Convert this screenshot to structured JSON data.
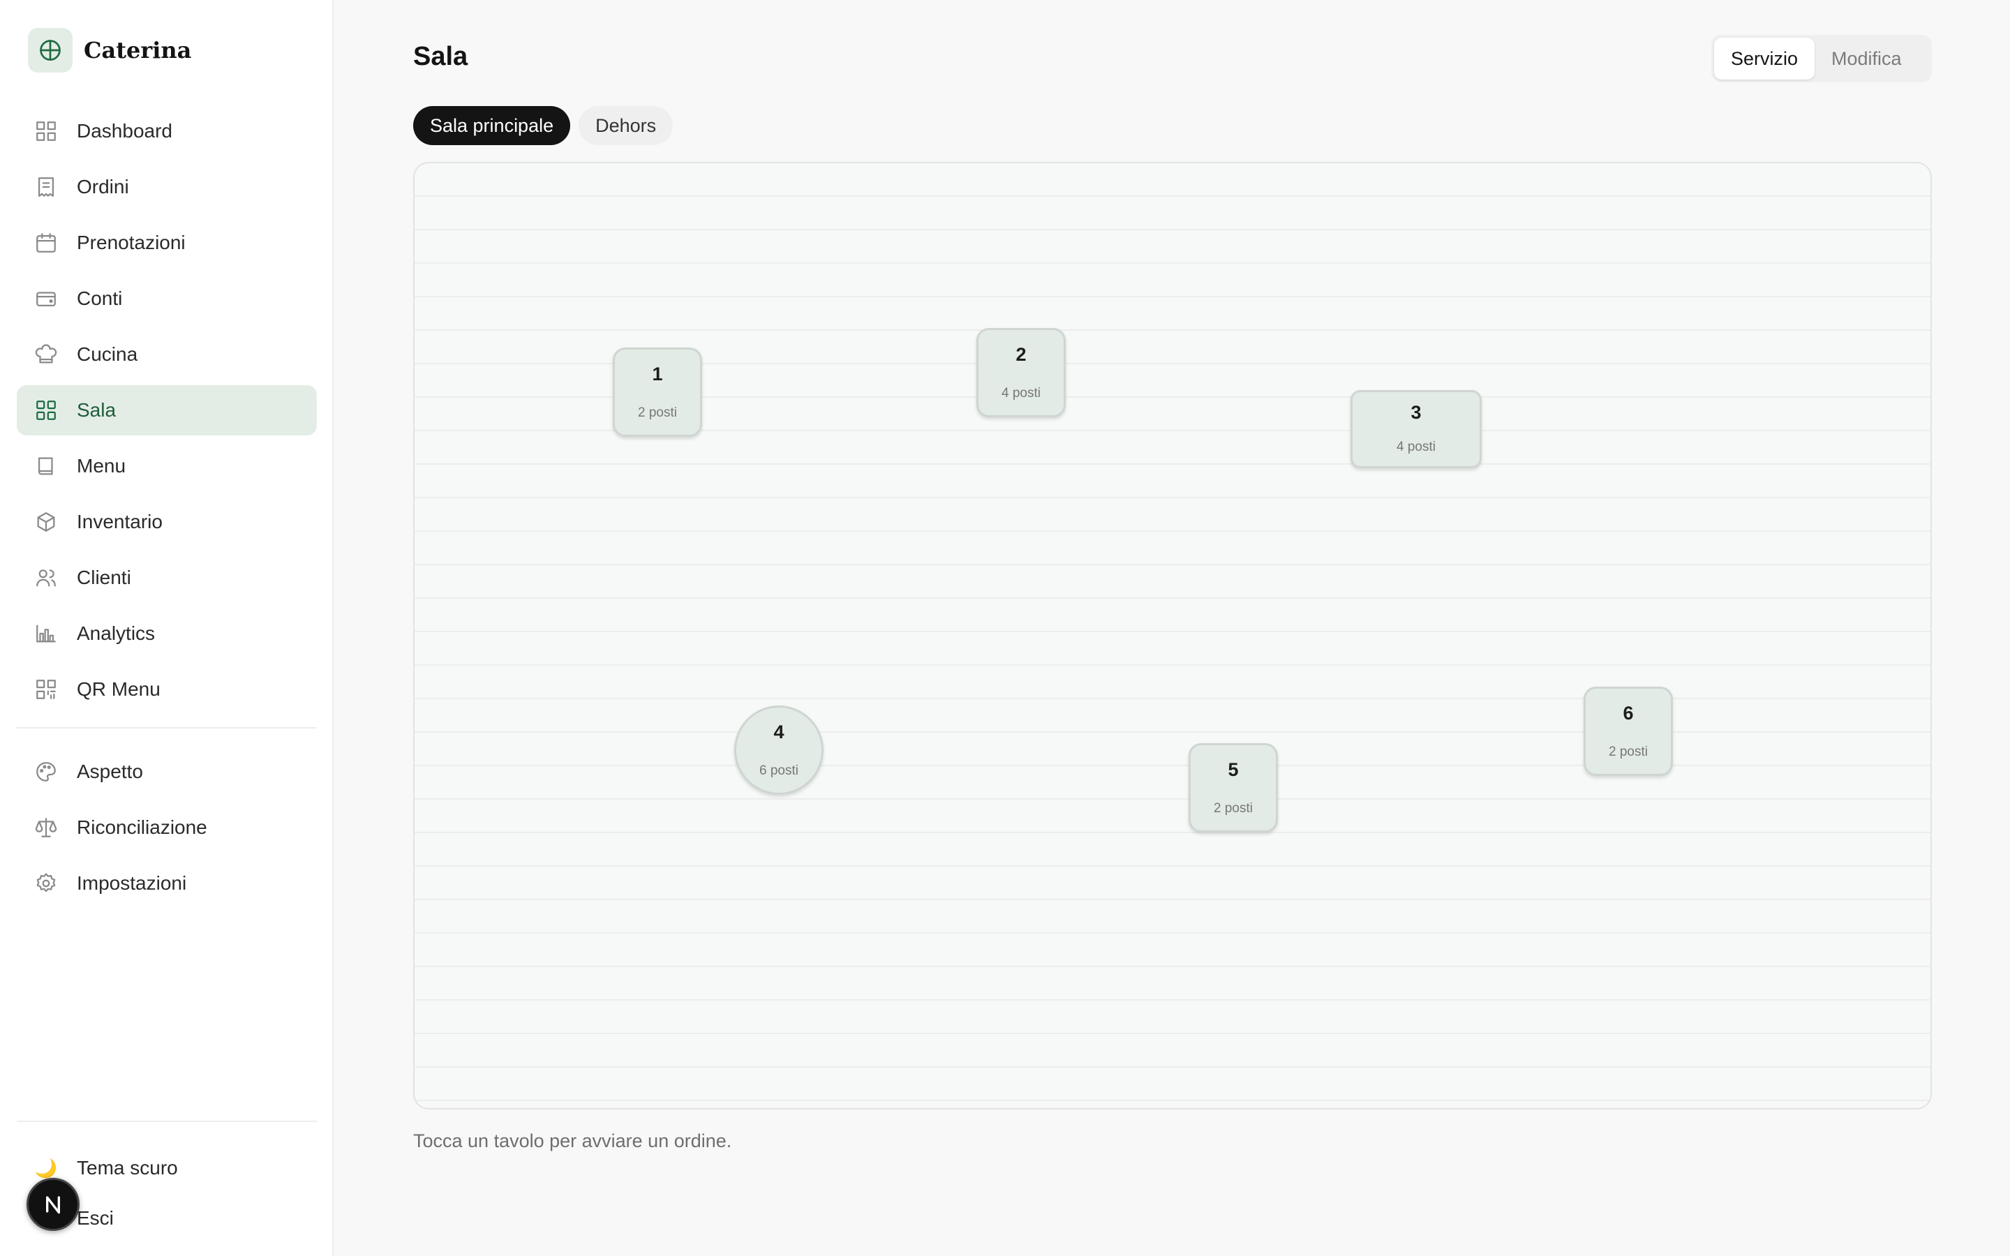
{
  "brand": {
    "name": "Caterina",
    "logo_icon": "globe-icon"
  },
  "sidebar": {
    "items": [
      {
        "label": "Dashboard",
        "icon": "dashboard-icon",
        "active": false
      },
      {
        "label": "Ordini",
        "icon": "receipt-icon",
        "active": false
      },
      {
        "label": "Prenotazioni",
        "icon": "calendar-icon",
        "active": false
      },
      {
        "label": "Conti",
        "icon": "wallet-icon",
        "active": false
      },
      {
        "label": "Cucina",
        "icon": "chef-hat-icon",
        "active": false
      },
      {
        "label": "Sala",
        "icon": "grid-icon",
        "active": true
      },
      {
        "label": "Menu",
        "icon": "book-icon",
        "active": false
      },
      {
        "label": "Inventario",
        "icon": "box-icon",
        "active": false
      },
      {
        "label": "Clienti",
        "icon": "users-icon",
        "active": false
      },
      {
        "label": "Analytics",
        "icon": "bar-chart-icon",
        "active": false
      },
      {
        "label": "QR Menu",
        "icon": "qr-code-icon",
        "active": false
      }
    ],
    "secondary_items": [
      {
        "label": "Aspetto",
        "icon": "palette-icon"
      },
      {
        "label": "Riconciliazione",
        "icon": "scale-icon"
      },
      {
        "label": "Impostazioni",
        "icon": "gear-icon"
      }
    ],
    "bottom": {
      "theme_label": "Tema scuro",
      "theme_icon": "🌙",
      "logout_label": "Esci"
    }
  },
  "header": {
    "title": "Sala",
    "modes": [
      {
        "label": "Servizio",
        "active": true
      },
      {
        "label": "Modifica",
        "active": false
      }
    ]
  },
  "rooms": [
    {
      "label": "Sala principale",
      "active": true
    },
    {
      "label": "Dehors",
      "active": false
    }
  ],
  "tables": [
    {
      "number": "1",
      "seats": "2 posti",
      "shape": "square"
    },
    {
      "number": "2",
      "seats": "4 posti",
      "shape": "square"
    },
    {
      "number": "3",
      "seats": "4 posti",
      "shape": "rect"
    },
    {
      "number": "4",
      "seats": "6 posti",
      "shape": "round"
    },
    {
      "number": "5",
      "seats": "2 posti",
      "shape": "square"
    },
    {
      "number": "6",
      "seats": "2 posti",
      "shape": "square"
    }
  ],
  "hint": "Tocca un tavolo per avviare un ordine.",
  "colors": {
    "accent": "#1f6b42",
    "accent_bg": "#e3ede6",
    "table_fill": "#e2ebe5"
  }
}
